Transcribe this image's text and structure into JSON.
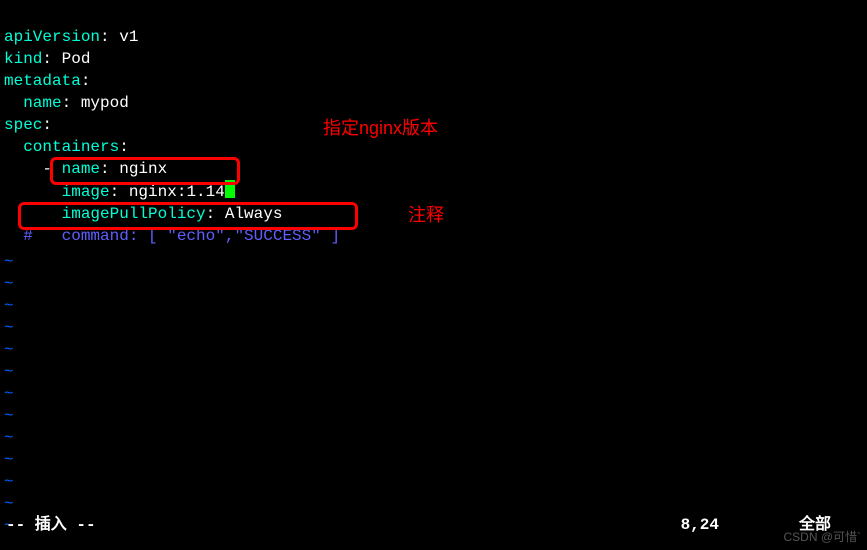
{
  "yaml": {
    "l1_key": "apiVersion",
    "l1_val": "v1",
    "l2_key": "kind",
    "l2_val": "Pod",
    "l3_key": "metadata",
    "l4_key": "name",
    "l4_val": "mypod",
    "l5_key": "spec",
    "l6_key": "containers",
    "l7_key": "name",
    "l7_val": "nginx",
    "l8_key": "image",
    "l8_val": "nginx:1.14",
    "l9_key": "imagePullPolicy",
    "l9_val": "Always",
    "l10_comment": "#   command: [ \"echo\",\"SUCCESS\" ]"
  },
  "annotations": {
    "a1": "指定nginx版本",
    "a2": "注释"
  },
  "status": {
    "mode": "-- 插入 --",
    "pos": "8,24",
    "scroll": "全部"
  },
  "watermark": "CSDN @可惜`"
}
